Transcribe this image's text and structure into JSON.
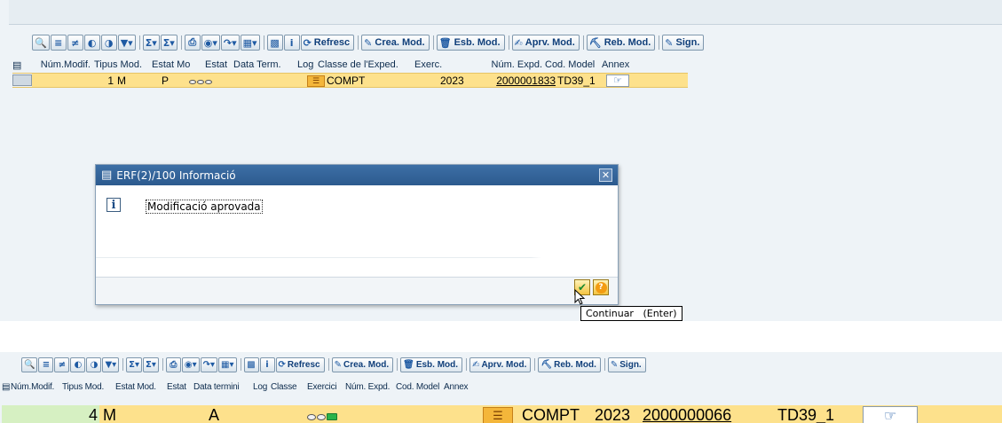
{
  "panel1": {
    "toolbar": {
      "icons": [
        "zoom-icon",
        "align-left-icon",
        "filter-rows-icon",
        "binoculars-icon",
        "binoculars-plus-icon",
        "funnel-icon",
        "sum-icon",
        "subtotal-icon",
        "print-icon",
        "view-icon",
        "export-icon",
        "layout-icon",
        "colors-icon",
        "info-icon"
      ],
      "buttons": {
        "refresh": "Refresc",
        "create": "Crea. Mod.",
        "delete": "Esb. Mod.",
        "approve": "Aprv. Mod.",
        "reject": "Reb. Mod.",
        "sign": "Sign."
      }
    },
    "table": {
      "headers": [
        "Núm.Modif.",
        "Tipus Mod.",
        "Estat Mo",
        "Estat",
        "Data Term.",
        "Log",
        "Classe de l'Exped.",
        "Exerc.",
        "Núm. Expd.",
        "Cod. Model",
        "Annex"
      ],
      "row": {
        "num_modif": "1",
        "tipus_mod": "M",
        "estat_mod": "P",
        "estat": "",
        "data_term": "",
        "log": "",
        "classe": "COMPT",
        "exerc": "2023",
        "num_expd": "2000001833",
        "cod_model": "TD39_1",
        "annex": ""
      }
    },
    "dialog": {
      "title": "ERF(2)/100 Informació",
      "message": "Modificació aprovada",
      "tooltip": "Continuar   (Enter)"
    }
  },
  "panel2": {
    "toolbar": {
      "buttons": {
        "refresh": "Refresc",
        "create": "Crea. Mod.",
        "delete": "Esb. Mod.",
        "approve": "Aprv. Mod.",
        "reject": "Reb. Mod.",
        "sign": "Sign."
      }
    },
    "table": {
      "headers": [
        "Núm.Modif.",
        "Tipus Mod.",
        "Estat Mod.",
        "Estat",
        "Data termini",
        "Log",
        "Classe",
        "Exercici",
        "Núm. Expd.",
        "Cod. Model",
        "Annex"
      ],
      "row": {
        "num_modif": "4",
        "tipus_mod": "M",
        "estat_mod": "A",
        "estat": "",
        "data_term": "",
        "log": "",
        "classe": "COMPT",
        "exerc": "2023",
        "num_expd": "2000000066",
        "cod_model": "TD39_1",
        "annex": ""
      }
    }
  },
  "colors": {
    "row_highlight": "#fde18c",
    "dialog_title_bar": "#2c5a8e",
    "link_text": "#000000",
    "status_green": "#2bb34a"
  }
}
